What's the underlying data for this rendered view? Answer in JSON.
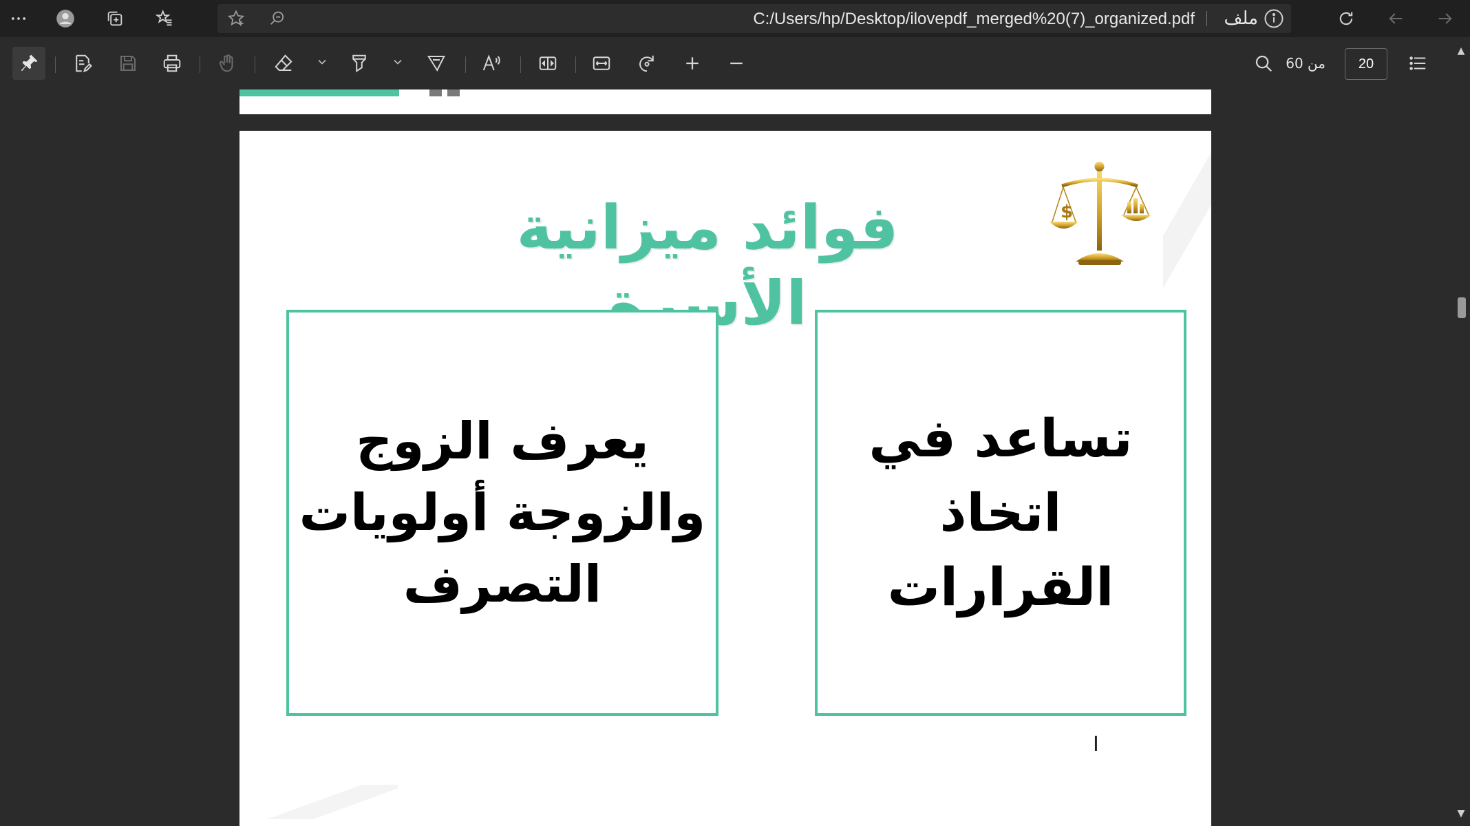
{
  "titlebar": {
    "url": "C:/Users/hp/Desktop/ilovepdf_merged%20(7)_organized.pdf",
    "file_label": "ملف"
  },
  "toolbar": {
    "page_of": "من 60",
    "current_page": "20"
  },
  "document": {
    "title": "فوائد ميزانية الأسرة",
    "cards": [
      {
        "text": "تساعد في اتخاذ\nالقرارات"
      },
      {
        "text": "يعرف الزوج\nوالزوجة أولويات\nالتصرف"
      }
    ]
  },
  "colors": {
    "accent": "#4fc3a1",
    "chrome_bg": "#202020",
    "toolbar_bg": "#2b2b2b"
  },
  "icons": [
    "more-icon",
    "profile-icon",
    "collections-icon",
    "favorites-icon",
    "add-favorite-icon",
    "zoom-icon",
    "info-icon",
    "refresh-icon",
    "back-icon",
    "forward-icon",
    "pin-icon",
    "edit-icon",
    "save-icon",
    "print-icon",
    "touch-icon",
    "eraser-icon",
    "highlighter-icon",
    "draw-icon",
    "read-aloud-icon",
    "page-view-icon",
    "fit-icon",
    "rotate-icon",
    "zoom-in-icon",
    "zoom-out-icon",
    "search-icon",
    "contents-icon",
    "scale-icon"
  ]
}
